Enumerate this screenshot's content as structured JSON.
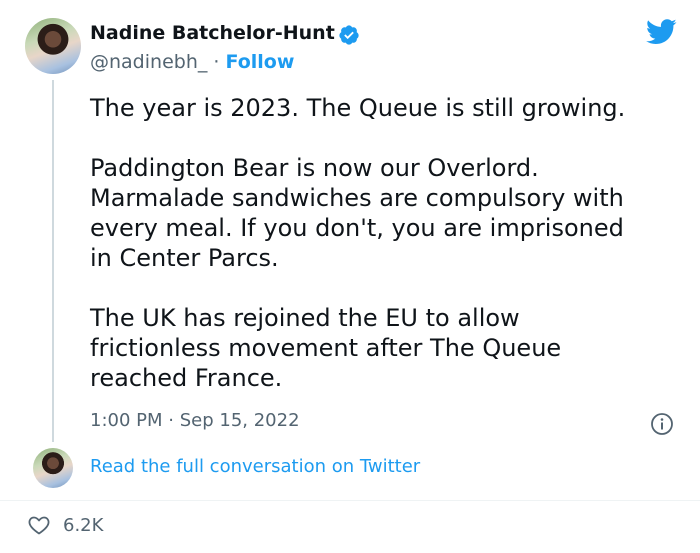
{
  "author": {
    "name": "Nadine Batchelor-Hunt",
    "handle": "@nadinebh_",
    "separator": "·",
    "follow_label": "Follow",
    "verified_icon": "verified-badge-icon"
  },
  "tweet": {
    "paragraphs": [
      "The year is 2023. The Queue is still growing.",
      "Paddington Bear is now our Overlord.\nMarmalade sandwiches are compulsory with\nevery meal. If you don't, you are imprisoned\nin Center Parcs.",
      "The UK has rejoined the EU to allow\nfrictionless movement after The Queue\nreached France."
    ],
    "time": "1:00 PM",
    "separator": "·",
    "date": "Sep 15, 2022"
  },
  "conversation": {
    "link_label": "Read the full conversation on Twitter"
  },
  "engagement": {
    "likes": "6.2K"
  },
  "colors": {
    "accent": "#1d9bf0",
    "text": "#0f1419",
    "secondary": "#536471"
  },
  "icons": [
    "twitter-logo-icon",
    "verified-badge-icon",
    "info-icon",
    "heart-icon"
  ]
}
